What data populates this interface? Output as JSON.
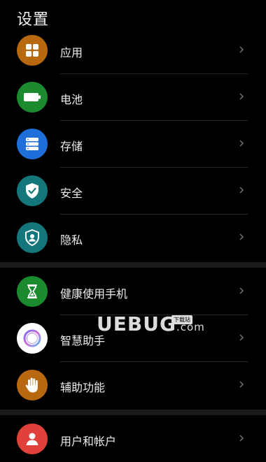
{
  "header": {
    "title": "设置"
  },
  "items": [
    {
      "label": "应用",
      "icon": "apps-grid-icon",
      "color": "#b8690f"
    },
    {
      "label": "电池",
      "icon": "battery-icon",
      "color": "#1c8a2e"
    },
    {
      "label": "存储",
      "icon": "storage-icon",
      "color": "#1e6fd9"
    },
    {
      "label": "安全",
      "icon": "shield-check-icon",
      "color": "#13767a"
    },
    {
      "label": "隐私",
      "icon": "privacy-icon",
      "color": "#13767a"
    },
    {
      "label": "健康使用手机",
      "icon": "hourglass-icon",
      "color": "#1c8a2e"
    },
    {
      "label": "智慧助手",
      "icon": "assistant-icon",
      "color": "#ffffff"
    },
    {
      "label": "辅助功能",
      "icon": "hand-icon",
      "color": "#b8690f"
    },
    {
      "label": "用户和帐户",
      "icon": "user-icon",
      "color": "#e0413a"
    }
  ],
  "watermark": {
    "text": "UEBUG",
    "suffix": ".com",
    "badge": "下载站"
  }
}
